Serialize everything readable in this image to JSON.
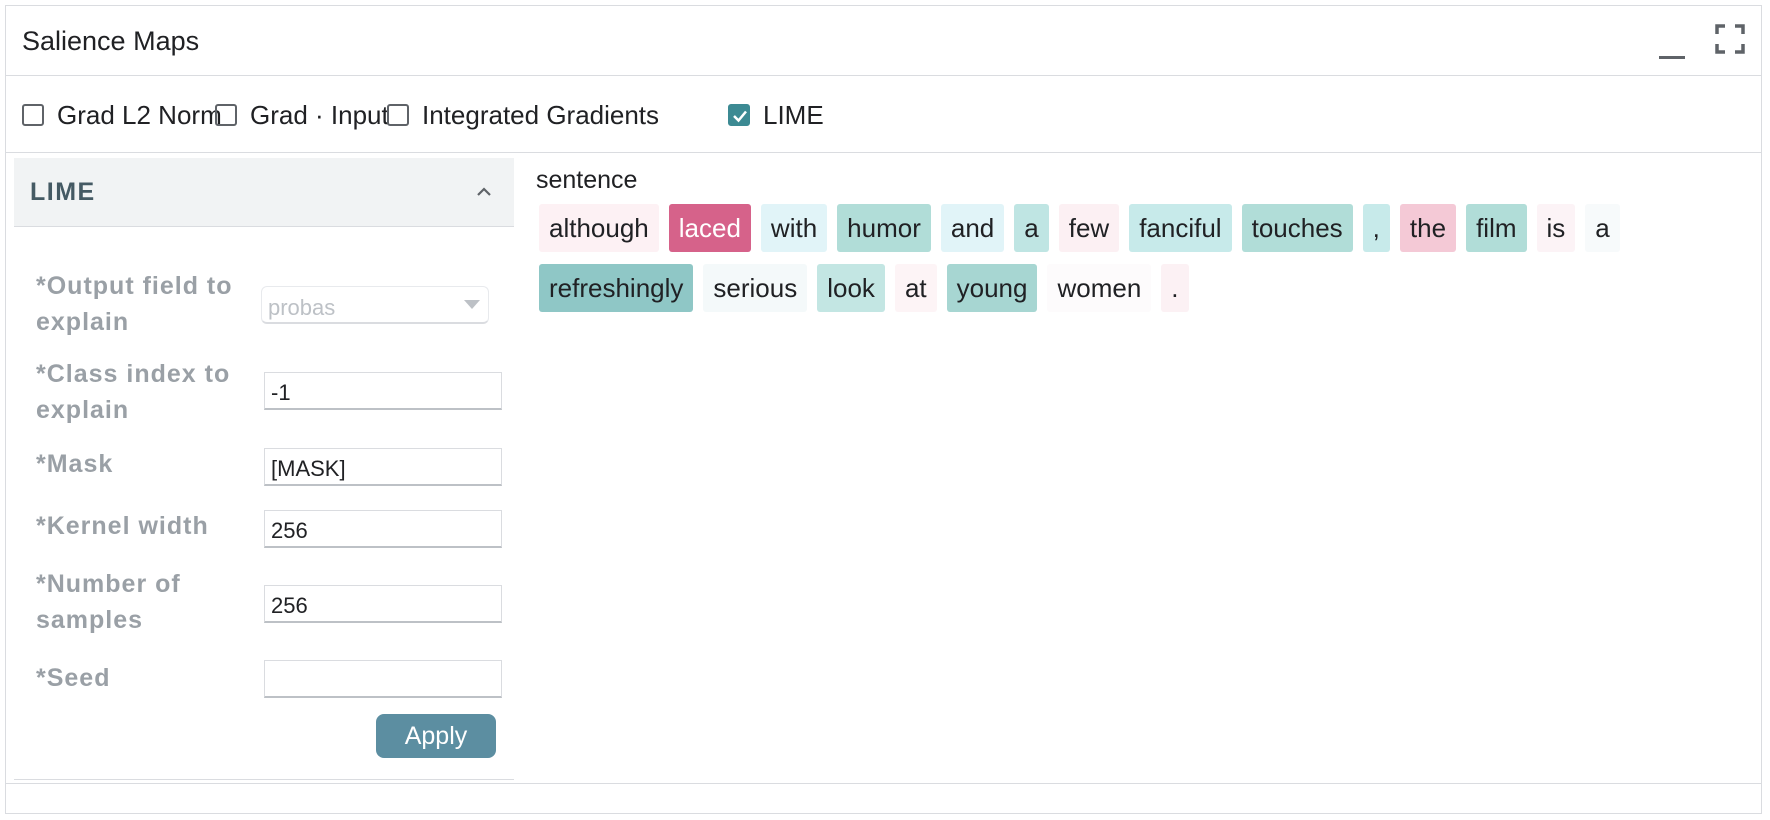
{
  "header": {
    "title": "Salience Maps"
  },
  "methods": [
    {
      "label": "Grad L2 Norm",
      "checked": false
    },
    {
      "label": "Grad · Input",
      "checked": false
    },
    {
      "label": "Integrated Gradients",
      "checked": false
    },
    {
      "label": "LIME",
      "checked": true
    }
  ],
  "panel": {
    "title": "LIME",
    "fields": {
      "output_field": {
        "label": "*Output field to explain",
        "value": "probas"
      },
      "class_index": {
        "label": "*Class index to explain",
        "value": "-1"
      },
      "mask": {
        "label": "*Mask",
        "value": "[MASK]"
      },
      "kernel_width": {
        "label": "*Kernel width",
        "value": "256"
      },
      "num_samples": {
        "label": "*Number of samples",
        "value": "256"
      },
      "seed": {
        "label": "*Seed",
        "value": ""
      }
    },
    "apply_label": "Apply"
  },
  "main": {
    "field_name": "sentence",
    "tokens": [
      {
        "text": "although",
        "color": "#fdf1f4",
        "text_color": "#202124"
      },
      {
        "text": "laced",
        "color": "#d6628a",
        "text_color": "#ffffff"
      },
      {
        "text": "with",
        "color": "#e1f4f8",
        "text_color": "#202124"
      },
      {
        "text": "humor",
        "color": "#b1ddd8",
        "text_color": "#202124"
      },
      {
        "text": "and",
        "color": "#e1f4f8",
        "text_color": "#202124"
      },
      {
        "text": "a",
        "color": "#bfe5e3",
        "text_color": "#202124"
      },
      {
        "text": "few",
        "color": "#fcf0f3",
        "text_color": "#202124"
      },
      {
        "text": "fanciful",
        "color": "#c7eaea",
        "text_color": "#202124"
      },
      {
        "text": "touches",
        "color": "#b1ddd8",
        "text_color": "#202124"
      },
      {
        "text": ",",
        "color": "#c7eaea",
        "text_color": "#202124"
      },
      {
        "text": "the",
        "color": "#f4c9d6",
        "text_color": "#202124"
      },
      {
        "text": "film",
        "color": "#b1ddd8",
        "text_color": "#202124"
      },
      {
        "text": "is",
        "color": "#fcf3f6",
        "text_color": "#202124"
      },
      {
        "text": "a",
        "color": "#f7fafb",
        "text_color": "#202124"
      },
      {
        "text": "refreshingly",
        "color": "#8fc7c6",
        "text_color": "#202124"
      },
      {
        "text": "serious",
        "color": "#f4f9fa",
        "text_color": "#202124"
      },
      {
        "text": "look",
        "color": "#c3e6e3",
        "text_color": "#202124"
      },
      {
        "text": "at",
        "color": "#fdf4f6",
        "text_color": "#202124"
      },
      {
        "text": "young",
        "color": "#a7d6d2",
        "text_color": "#202124"
      },
      {
        "text": "women",
        "color": "#fdfbfc",
        "text_color": "#202124"
      },
      {
        "text": ".",
        "color": "#fcf1f4",
        "text_color": "#202124"
      }
    ]
  },
  "icons": {
    "minimize": "minimize-icon",
    "fullscreen": "fullscreen-icon",
    "collapse": "chevron-up-icon",
    "dropdown": "dropdown-arrow-icon"
  },
  "colors": {
    "accent": "#3c8a93",
    "apply_button": "#5c8ea1",
    "panel_title": "#455a64"
  }
}
